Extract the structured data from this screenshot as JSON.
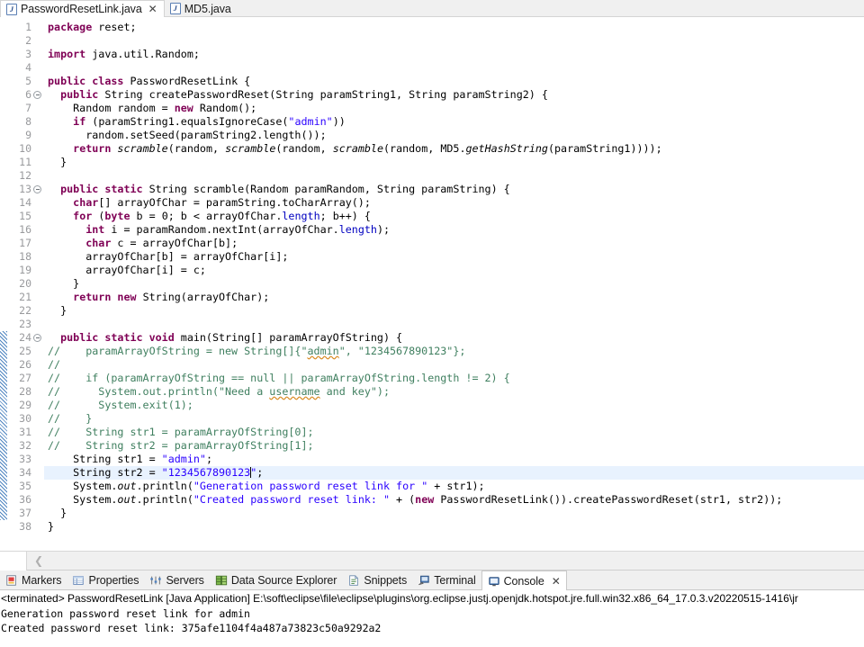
{
  "editor_tabs": [
    {
      "label": "PasswordResetLink.java",
      "icon": "java-file-icon",
      "active": true,
      "closable": true,
      "close_label": "✕"
    },
    {
      "label": "MD5.java",
      "icon": "java-file-icon",
      "active": false,
      "closable": false,
      "close_label": ""
    }
  ],
  "editor": {
    "first_line": 1,
    "last_line": 38,
    "highlighted_line": 34,
    "fold_lines": [
      6,
      13,
      24
    ],
    "change_bar_range": [
      24,
      37
    ],
    "lines": [
      {
        "n": 1,
        "segments": [
          {
            "t": "package ",
            "c": "kw"
          },
          {
            "t": "reset;",
            "c": "pln"
          }
        ]
      },
      {
        "n": 2,
        "segments": []
      },
      {
        "n": 3,
        "segments": [
          {
            "t": "import ",
            "c": "kw"
          },
          {
            "t": "java.util.Random;",
            "c": "pln"
          }
        ]
      },
      {
        "n": 4,
        "segments": []
      },
      {
        "n": 5,
        "segments": [
          {
            "t": "public class ",
            "c": "kw"
          },
          {
            "t": "PasswordResetLink {",
            "c": "pln"
          }
        ]
      },
      {
        "n": 6,
        "segments": [
          {
            "t": "  ",
            "c": "pln"
          },
          {
            "t": "public ",
            "c": "kw"
          },
          {
            "t": "String createPasswordReset(String paramString1, String paramString2) {",
            "c": "pln"
          }
        ]
      },
      {
        "n": 7,
        "segments": [
          {
            "t": "    Random random = ",
            "c": "pln"
          },
          {
            "t": "new ",
            "c": "kw"
          },
          {
            "t": "Random();",
            "c": "pln"
          }
        ]
      },
      {
        "n": 8,
        "segments": [
          {
            "t": "    ",
            "c": "pln"
          },
          {
            "t": "if ",
            "c": "kw"
          },
          {
            "t": "(paramString1.equalsIgnoreCase(",
            "c": "pln"
          },
          {
            "t": "\"admin\"",
            "c": "str"
          },
          {
            "t": "))",
            "c": "pln"
          }
        ]
      },
      {
        "n": 9,
        "segments": [
          {
            "t": "      random.setSeed(paramString2.length());",
            "c": "pln"
          }
        ]
      },
      {
        "n": 10,
        "segments": [
          {
            "t": "    ",
            "c": "pln"
          },
          {
            "t": "return ",
            "c": "kw"
          },
          {
            "t": "scramble",
            "c": "stat"
          },
          {
            "t": "(random, ",
            "c": "pln"
          },
          {
            "t": "scramble",
            "c": "stat"
          },
          {
            "t": "(random, ",
            "c": "pln"
          },
          {
            "t": "scramble",
            "c": "stat"
          },
          {
            "t": "(random, MD5.",
            "c": "pln"
          },
          {
            "t": "getHashString",
            "c": "stat"
          },
          {
            "t": "(paramString1))));",
            "c": "pln"
          }
        ]
      },
      {
        "n": 11,
        "segments": [
          {
            "t": "  }",
            "c": "pln"
          }
        ]
      },
      {
        "n": 12,
        "segments": []
      },
      {
        "n": 13,
        "segments": [
          {
            "t": "  ",
            "c": "pln"
          },
          {
            "t": "public static ",
            "c": "kw"
          },
          {
            "t": "String scramble(Random paramRandom, String paramString) {",
            "c": "pln"
          }
        ]
      },
      {
        "n": 14,
        "segments": [
          {
            "t": "    ",
            "c": "pln"
          },
          {
            "t": "char",
            "c": "kw"
          },
          {
            "t": "[] arrayOfChar = paramString.toCharArray();",
            "c": "pln"
          }
        ]
      },
      {
        "n": 15,
        "segments": [
          {
            "t": "    ",
            "c": "pln"
          },
          {
            "t": "for ",
            "c": "kw"
          },
          {
            "t": "(",
            "c": "pln"
          },
          {
            "t": "byte ",
            "c": "kw"
          },
          {
            "t": "b = 0; b < arrayOfChar.",
            "c": "pln"
          },
          {
            "t": "length",
            "c": "fld"
          },
          {
            "t": "; b++) {",
            "c": "pln"
          }
        ]
      },
      {
        "n": 16,
        "segments": [
          {
            "t": "      ",
            "c": "pln"
          },
          {
            "t": "int ",
            "c": "kw"
          },
          {
            "t": "i = paramRandom.nextInt(arrayOfChar.",
            "c": "pln"
          },
          {
            "t": "length",
            "c": "fld"
          },
          {
            "t": ");",
            "c": "pln"
          }
        ]
      },
      {
        "n": 17,
        "segments": [
          {
            "t": "      ",
            "c": "pln"
          },
          {
            "t": "char ",
            "c": "kw"
          },
          {
            "t": "c = arrayOfChar[b];",
            "c": "pln"
          }
        ]
      },
      {
        "n": 18,
        "segments": [
          {
            "t": "      arrayOfChar[b] = arrayOfChar[i];",
            "c": "pln"
          }
        ]
      },
      {
        "n": 19,
        "segments": [
          {
            "t": "      arrayOfChar[i] = c;",
            "c": "pln"
          }
        ]
      },
      {
        "n": 20,
        "segments": [
          {
            "t": "    }",
            "c": "pln"
          }
        ]
      },
      {
        "n": 21,
        "segments": [
          {
            "t": "    ",
            "c": "pln"
          },
          {
            "t": "return new ",
            "c": "kw"
          },
          {
            "t": "String(arrayOfChar);",
            "c": "pln"
          }
        ]
      },
      {
        "n": 22,
        "segments": [
          {
            "t": "  }",
            "c": "pln"
          }
        ]
      },
      {
        "n": 23,
        "segments": []
      },
      {
        "n": 24,
        "segments": [
          {
            "t": "  ",
            "c": "pln"
          },
          {
            "t": "public static void ",
            "c": "kw"
          },
          {
            "t": "main(String[] paramArrayOfString) {",
            "c": "pln"
          }
        ]
      },
      {
        "n": 25,
        "segments": [
          {
            "t": "//    paramArrayOfString = new String[]{\"",
            "c": "cmt"
          },
          {
            "t": "admin",
            "c": "cmt-squig"
          },
          {
            "t": "\", \"1234567890123\"};",
            "c": "cmt"
          }
        ]
      },
      {
        "n": 26,
        "segments": [
          {
            "t": "//",
            "c": "cmt"
          }
        ]
      },
      {
        "n": 27,
        "segments": [
          {
            "t": "//    if (paramArrayOfString == null || paramArrayOfString.length != 2) {",
            "c": "cmt"
          }
        ]
      },
      {
        "n": 28,
        "segments": [
          {
            "t": "//      System.out.println(\"Need a ",
            "c": "cmt"
          },
          {
            "t": "username",
            "c": "cmt-squig"
          },
          {
            "t": " and key\");",
            "c": "cmt"
          }
        ]
      },
      {
        "n": 29,
        "segments": [
          {
            "t": "//      System.exit(1);",
            "c": "cmt"
          }
        ]
      },
      {
        "n": 30,
        "segments": [
          {
            "t": "//    }",
            "c": "cmt"
          }
        ]
      },
      {
        "n": 31,
        "segments": [
          {
            "t": "//    String str1 = paramArrayOfString[0];",
            "c": "cmt"
          }
        ]
      },
      {
        "n": 32,
        "segments": [
          {
            "t": "//    String str2 = paramArrayOfString[1];",
            "c": "cmt"
          }
        ]
      },
      {
        "n": 33,
        "segments": [
          {
            "t": "    String str1 = ",
            "c": "pln"
          },
          {
            "t": "\"admin\"",
            "c": "str"
          },
          {
            "t": ";",
            "c": "pln"
          }
        ]
      },
      {
        "n": 34,
        "segments": [
          {
            "t": "    String str2 = ",
            "c": "pln"
          },
          {
            "t": "\"1234567890123",
            "c": "str"
          },
          {
            "t": "|CARET|",
            "c": "caret"
          },
          {
            "t": "\"",
            "c": "str"
          },
          {
            "t": ";",
            "c": "pln"
          }
        ]
      },
      {
        "n": 35,
        "segments": [
          {
            "t": "    System.",
            "c": "pln"
          },
          {
            "t": "out",
            "c": "stat"
          },
          {
            "t": ".println(",
            "c": "pln"
          },
          {
            "t": "\"Generation password reset link for \"",
            "c": "str"
          },
          {
            "t": " + str1);",
            "c": "pln"
          }
        ]
      },
      {
        "n": 36,
        "segments": [
          {
            "t": "    System.",
            "c": "pln"
          },
          {
            "t": "out",
            "c": "stat"
          },
          {
            "t": ".println(",
            "c": "pln"
          },
          {
            "t": "\"Created password reset link: \"",
            "c": "str"
          },
          {
            "t": " + (",
            "c": "pln"
          },
          {
            "t": "new ",
            "c": "kw"
          },
          {
            "t": "PasswordResetLink()).createPasswordReset(str1, str2));",
            "c": "pln"
          }
        ]
      },
      {
        "n": 37,
        "segments": [
          {
            "t": "  }",
            "c": "pln"
          }
        ]
      },
      {
        "n": 38,
        "segments": [
          {
            "t": "}",
            "c": "pln"
          }
        ]
      }
    ]
  },
  "view_tabs": [
    {
      "label": "Markers",
      "icon": "markers-icon",
      "active": false,
      "closable": false
    },
    {
      "label": "Properties",
      "icon": "properties-icon",
      "active": false,
      "closable": false
    },
    {
      "label": "Servers",
      "icon": "servers-icon",
      "active": false,
      "closable": false
    },
    {
      "label": "Data Source Explorer",
      "icon": "data-source-explorer-icon",
      "active": false,
      "closable": false
    },
    {
      "label": "Snippets",
      "icon": "snippets-icon",
      "active": false,
      "closable": false
    },
    {
      "label": "Terminal",
      "icon": "terminal-icon",
      "active": false,
      "closable": false
    },
    {
      "label": "Console",
      "icon": "console-icon",
      "active": true,
      "closable": true,
      "close_label": "✕"
    }
  ],
  "console": {
    "header": "<terminated> PasswordResetLink [Java Application] E:\\soft\\eclipse\\file\\eclipse\\plugins\\org.eclipse.justj.openjdk.hotspot.jre.full.win32.x86_64_17.0.3.v20220515-1416\\jr",
    "output_lines": [
      "Generation password reset link for admin",
      "Created password reset link: 375afe1104f4a487a73823c50a9292a2"
    ]
  },
  "colors": {
    "keyword": "#7f0055",
    "string": "#2a00ff",
    "comment": "#3f7f5f",
    "field": "#0000c0",
    "line_highlight": "#e8f2fe",
    "change_bar": "#2f6fb5",
    "spell_squiggle": "#d88a20"
  }
}
